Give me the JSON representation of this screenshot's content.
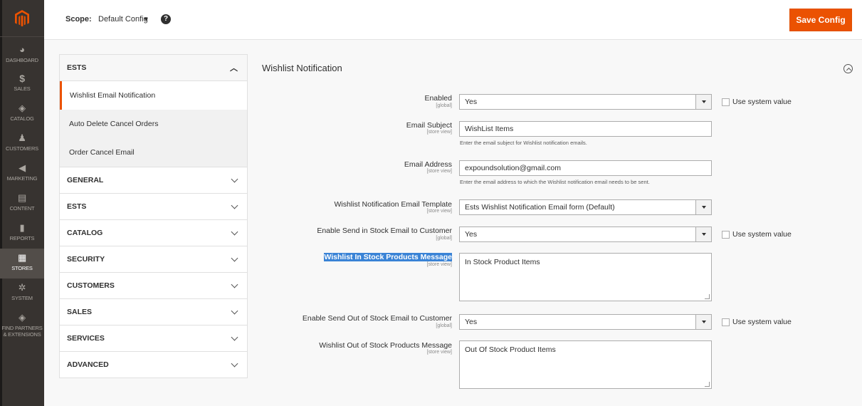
{
  "sidebar": {
    "items": [
      {
        "label": "DASHBOARD",
        "icon": "dashboard-icon",
        "glyph": "◕"
      },
      {
        "label": "SALES",
        "icon": "dollar-icon",
        "glyph": "$"
      },
      {
        "label": "CATALOG",
        "icon": "cube-icon",
        "glyph": "◈"
      },
      {
        "label": "CUSTOMERS",
        "icon": "person-icon",
        "glyph": "♟"
      },
      {
        "label": "MARKETING",
        "icon": "megaphone-icon",
        "glyph": "◀"
      },
      {
        "label": "CONTENT",
        "icon": "layout-icon",
        "glyph": "▤"
      },
      {
        "label": "REPORTS",
        "icon": "bar-chart-icon",
        "glyph": "▮"
      },
      {
        "label": "STORES",
        "icon": "store-icon",
        "glyph": "▦"
      },
      {
        "label": "SYSTEM",
        "icon": "gear-icon",
        "glyph": "✲"
      },
      {
        "label": "FIND PARTNERS & EXTENSIONS",
        "icon": "box-icon",
        "glyph": "◈"
      }
    ],
    "active": "STORES"
  },
  "topbar": {
    "scope_label": "Scope:",
    "scope_value": "Default Config",
    "help": "?",
    "save_label": "Save Config"
  },
  "tabs": {
    "open_group": "ESTS",
    "open_items": [
      "Wishlist Email Notification",
      "Auto Delete Cancel Orders",
      "Order Cancel Email"
    ],
    "groups": [
      "GENERAL",
      "ESTS",
      "CATALOG",
      "SECURITY",
      "CUSTOMERS",
      "SALES",
      "SERVICES",
      "ADVANCED"
    ]
  },
  "section": {
    "title": "Wishlist Notification",
    "fields": {
      "enabled": {
        "label": "Enabled",
        "scope": "[global]",
        "value": "Yes",
        "system": "Use system value"
      },
      "email_subject": {
        "label": "Email Subject",
        "scope": "[store view]",
        "value": "WishList Items",
        "note": "Enter the email subject for Wishlist notification emails."
      },
      "email_address": {
        "label": "Email Address",
        "scope": "[store view]",
        "value": "expoundsolution@gmail.com",
        "note": "Enter the email address to which the Wishlist notification email needs to be sent."
      },
      "template": {
        "label": "Wishlist Notification Email Template",
        "scope": "[store view]",
        "value": "Ests Wishlist Notification Email form (Default)"
      },
      "in_stock_enable": {
        "label": "Enable Send in Stock Email to Customer",
        "scope": "[global]",
        "value": "Yes",
        "system": "Use system value"
      },
      "in_stock_message": {
        "label": "Wishlist In Stock Products Message",
        "scope": "[store view]",
        "value": "In Stock Product Items"
      },
      "out_stock_enable": {
        "label": "Enable Send Out of Stock Email to Customer",
        "scope": "[global]",
        "value": "Yes",
        "system": "Use system value"
      },
      "out_stock_message": {
        "label": "Wishlist Out of Stock Products Message",
        "scope": "[store view]",
        "value": "Out Of Stock Product Items"
      }
    }
  },
  "colors": {
    "accent": "#eb5202",
    "sidebar_bg": "#373330",
    "selection": "#3a83d6"
  }
}
